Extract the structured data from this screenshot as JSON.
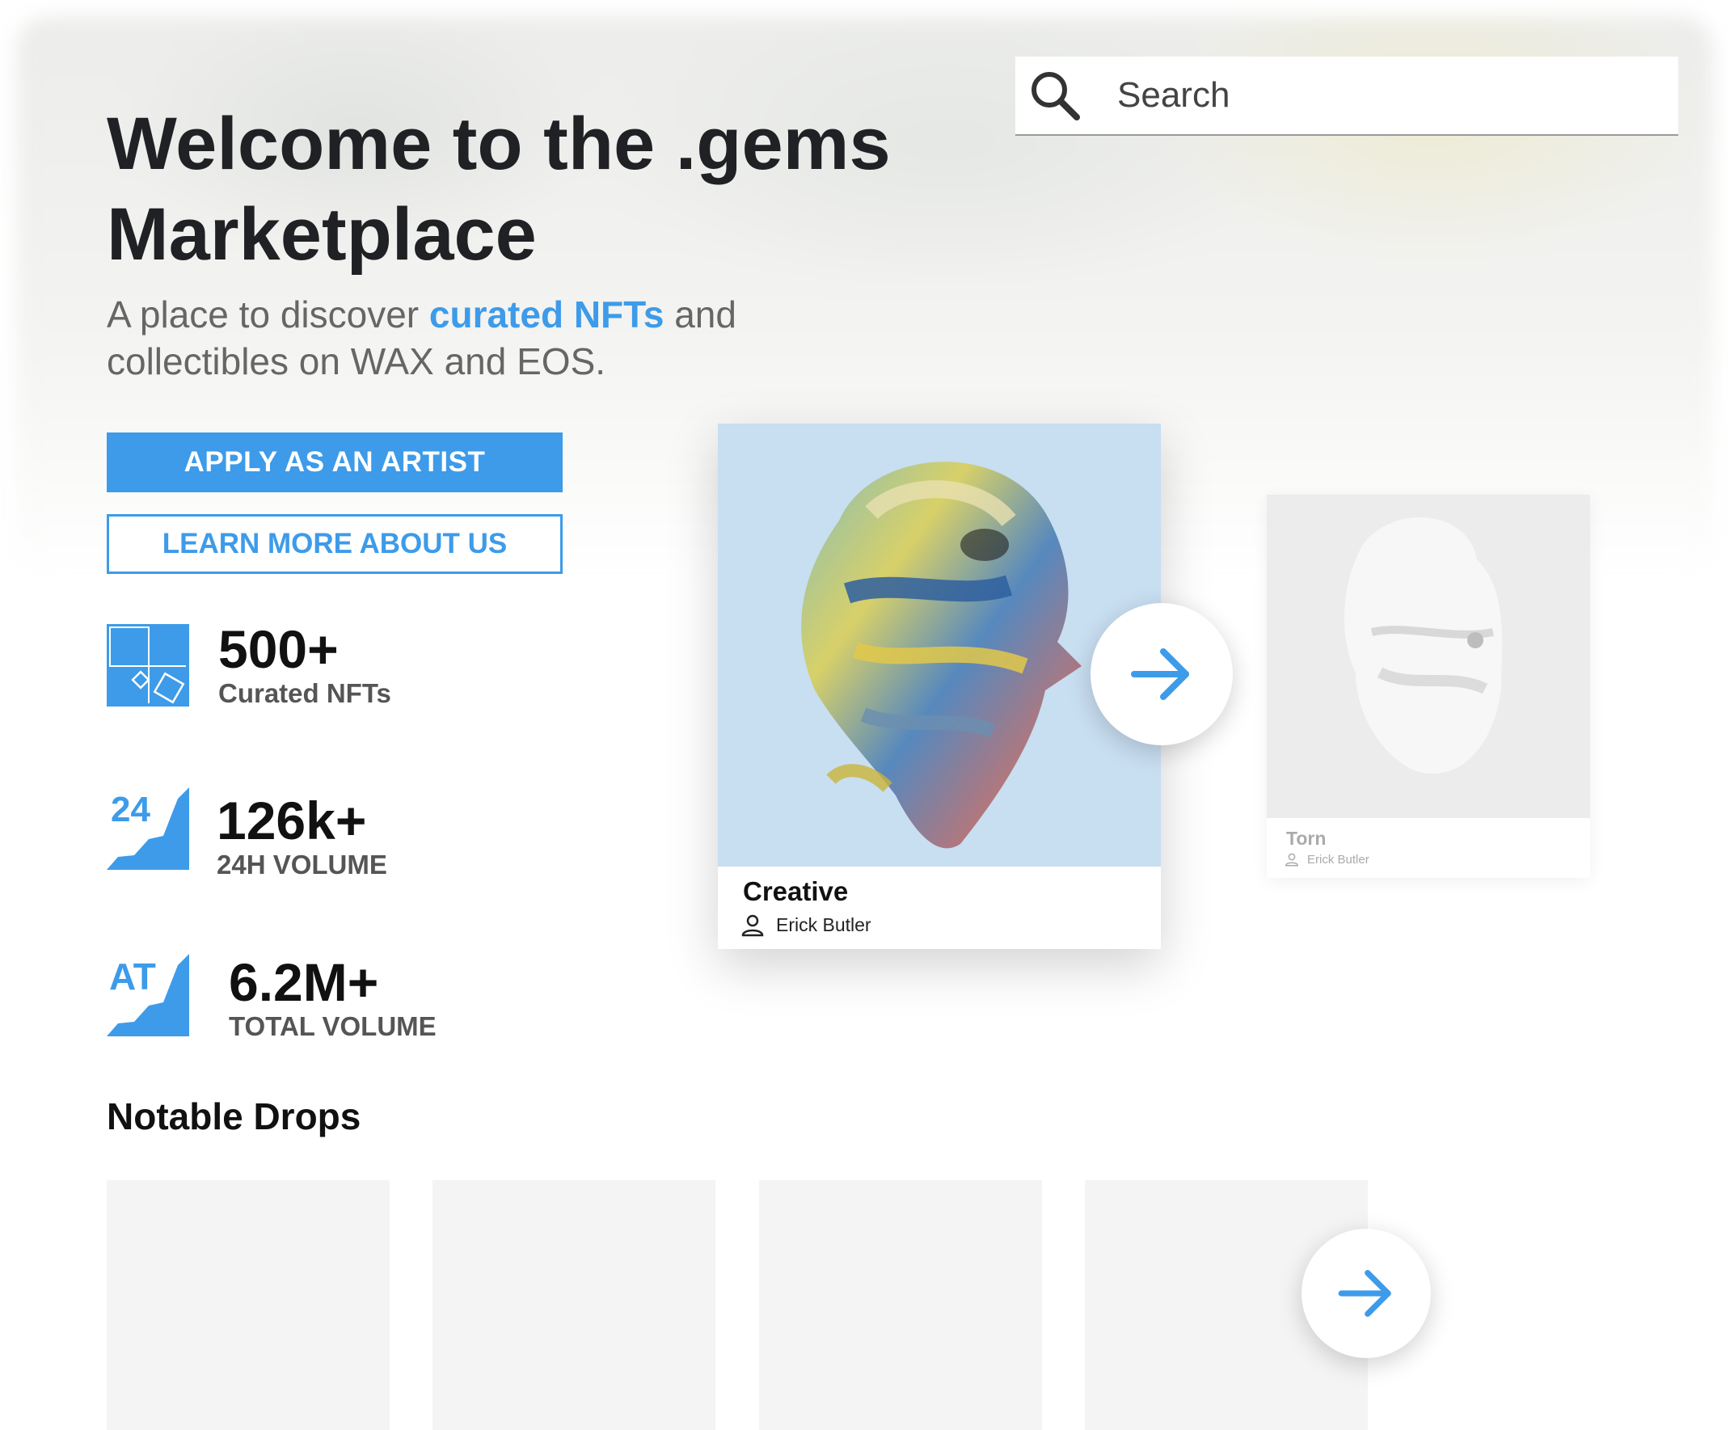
{
  "hero": {
    "title": "Welcome to the .gems Marketplace",
    "subtitle_pre": "A place to discover ",
    "subtitle_highlight": "curated NFTs",
    "subtitle_post": " and collectibles on WAX and EOS."
  },
  "search": {
    "placeholder": "Search",
    "icon": "search-icon"
  },
  "buttons": {
    "apply": "APPLY AS AN ARTIST",
    "learn_more": "LEARN MORE ABOUT US"
  },
  "stats": [
    {
      "value": "500+",
      "label": "Curated NFTs",
      "icon": "curated-grid-icon"
    },
    {
      "value": "126k+",
      "label": "24H VOLUME",
      "icon_text": "24",
      "icon": "volume-24h-icon"
    },
    {
      "value": "6.2M+",
      "label": "TOTAL VOLUME",
      "icon_text": "AT",
      "icon": "volume-alltime-icon"
    }
  ],
  "featured": [
    {
      "title": "Creative",
      "artist": "Erick Butler"
    },
    {
      "title": "Torn",
      "artist": "Erick Butler"
    }
  ],
  "notable_drops": {
    "title": "Notable Drops"
  },
  "colors": {
    "accent": "#3d9be9",
    "text_dark": "#202124",
    "text_muted": "#666666"
  }
}
